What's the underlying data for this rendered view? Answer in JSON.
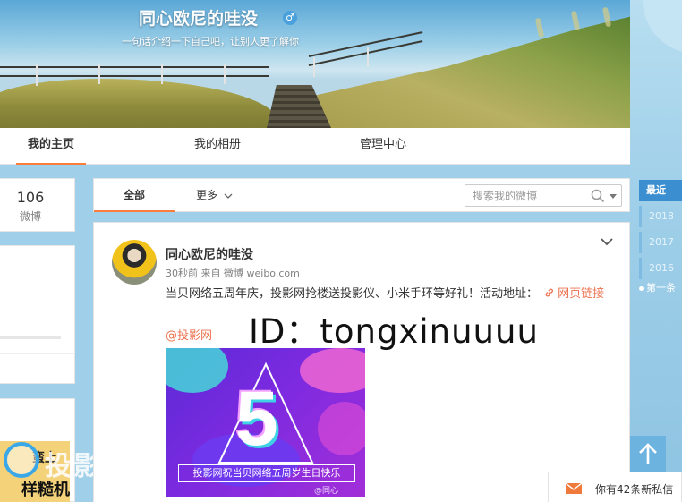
{
  "profile": {
    "name": "同心欧尼的哇没",
    "gender_symbol": "♂",
    "bio": "一句话介绍一下自己吧，让别人更了解你"
  },
  "nav": {
    "tabs": [
      {
        "label": "我的主页",
        "active": true
      },
      {
        "label": "我的相册",
        "active": false
      },
      {
        "label": "管理中心",
        "active": false
      }
    ]
  },
  "stats": {
    "weibo_count": "106",
    "weibo_label": "微博"
  },
  "feed_tabs": {
    "all": "全部",
    "more": "更多",
    "search_placeholder": "搜索我的微博"
  },
  "post": {
    "author": "同心欧尼的哇没",
    "time": "30秒前",
    "source": "来自 微博 weibo.com",
    "text": "当贝网络五周年庆，投影网抢楼送投影仪、小米手环等好礼！活动地址：",
    "link_text": "网页链接",
    "mention": "@投影网",
    "image": {
      "big_text": "5",
      "caption": "投影网祝当贝网络五周岁生日快乐",
      "watermark": "@同心"
    }
  },
  "overlay": {
    "id_text": "ID：tongxinuuuu"
  },
  "timeline": {
    "recent": "最近",
    "years": [
      "2018",
      "2017",
      "2016"
    ],
    "first": "第一条"
  },
  "message_bar": {
    "text": "你有42条新私信"
  },
  "watermark": {
    "site_text": "投影网",
    "thumb_top": "蛮上",
    "thumb_bottom": "样糙机"
  },
  "colors": {
    "accent_orange": "#fa7d3c",
    "link_orange": "#eb7350",
    "timeline_blue": "#3b8fd1",
    "page_bg_blue": "#9fcfe9"
  }
}
